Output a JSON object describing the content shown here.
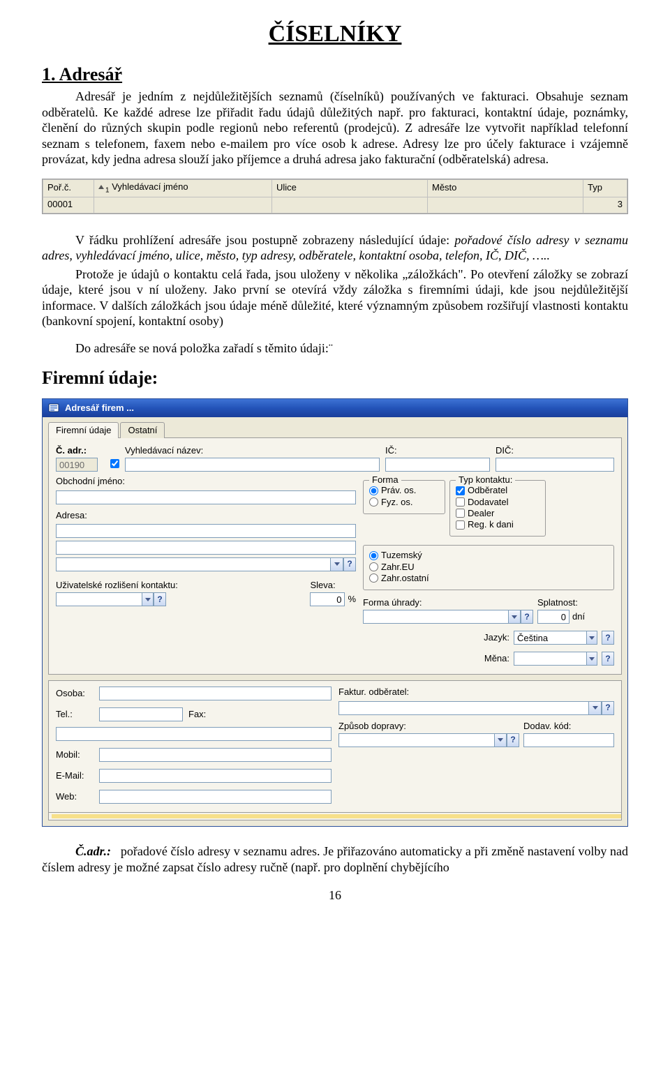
{
  "doc": {
    "title": "ČÍSELNÍKY",
    "h1": "1. Adresář",
    "para1": "Adresář je jedním z nejdůležitějších seznamů (číselníků) používaných ve fakturaci. Obsahuje seznam odběratelů. Ke každé adrese lze přiřadit řadu údajů důležitých např. pro fakturaci, kontaktní údaje, poznámky, členění do různých skupin podle regionů nebo referentů (prodejců). Z adresáře lze vytvořit například telefonní seznam s telefonem, faxem nebo e-mailem pro více osob k adrese. Adresy lze pro účely fakturace i vzájemně provázat, kdy jedna adresa slouží jako příjemce a druhá adresa jako fakturační (odběratelská) adresa.",
    "para2a": "V řádku prohlížení adresáře jsou postupně zobrazeny následující údaje: ",
    "para2b": "pořadové číslo adresy v seznamu adres, vyhledávací jméno, ulice, město, typ adresy, odběratele, kontaktní osoba, telefon, IČ, DIČ, …..",
    "para3": "Protože je údajů o kontaktu celá řada, jsou uloženy v několika „záložkách\". Po otevření záložky se zobrazí údaje, které jsou v ní uloženy. Jako první se otevírá vždy záložka s firemními údaji, kde jsou nejdůležitější informace. V dalších záložkách jsou údaje méně důležité, které významným způsobem rozšiřují vlastnosti kontaktu (bankovní spojení, kontaktní osoby)",
    "para4": "Do adresáře se nová položka zařadí s těmito údaji:¨",
    "h2": "Firemní údaje:",
    "para5a": "Č.adr.:",
    "para5b": "pořadové číslo adresy v seznamu adres. Je přiřazováno automaticky a při změně nastavení volby nad číslem adresy je možné zapsat číslo adresy ručně (např. pro doplnění chybějícího",
    "pageno": "16"
  },
  "table": {
    "headers": {
      "por": "Poř.č.",
      "jmeno": "Vyhledávací jméno",
      "ulice": "Ulice",
      "mesto": "Město",
      "typ": "Typ"
    },
    "sortidx": "1",
    "row": {
      "por": "00001",
      "jmeno": "",
      "ulice": "",
      "mesto": "",
      "typ": "3"
    }
  },
  "win": {
    "title": "Adresář firem ...",
    "tabs": {
      "firemni": "Firemní údaje",
      "ostatni": "Ostatní"
    },
    "labels": {
      "c_adr": "Č. adr.:",
      "vyhl_nazev": "Vyhledávací název:",
      "ic": "IČ:",
      "dic": "DIČ:",
      "obch_jmeno": "Obchodní jméno:",
      "adresa": "Adresa:",
      "forma": "Forma",
      "prav_os": "Práv. os.",
      "fyz_os": "Fyz. os.",
      "typ_kontaktu": "Typ kontaktu:",
      "odberatel": "Odběratel",
      "dodavatel": "Dodavatel",
      "dealer": "Dealer",
      "reg_k_dani": "Reg. k dani",
      "tuzemsky": "Tuzemský",
      "zahr_eu": "Zahr.EU",
      "zahr_ostatni": "Zahr.ostatní",
      "forma_uhrady": "Forma úhrady:",
      "splatnost": "Splatnost:",
      "dni": "dní",
      "jazyk": "Jazyk:",
      "mena": "Měna:",
      "uziv_rozliseni": "Uživatelské rozlišení kontaktu:",
      "sleva": "Sleva:",
      "percent": "%",
      "osoba": "Osoba:",
      "tel": "Tel.:",
      "fax": "Fax:",
      "mobil": "Mobil:",
      "email": "E-Mail:",
      "web": "Web:",
      "fakt_odberatel": "Faktur. odběratel:",
      "zpusob_dopravy": "Způsob dopravy:",
      "dodav_kod": "Dodav. kód:"
    },
    "values": {
      "c_adr": "00190",
      "splatnost": "0",
      "sleva": "0",
      "jazyk": "Čeština"
    }
  }
}
